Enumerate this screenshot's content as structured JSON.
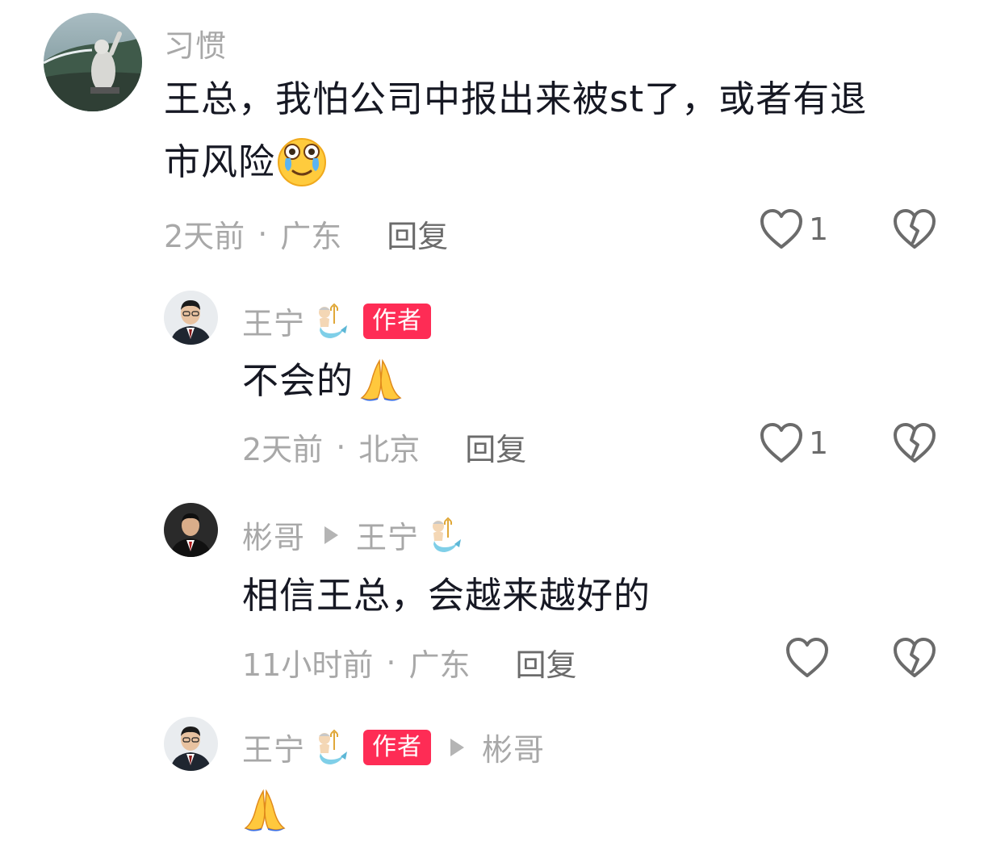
{
  "comments": [
    {
      "username": "习惯",
      "text": "王总，我怕公司中报出来被st了，或者有退市风险",
      "text_line1": "王总，我怕公司中报出来被st了，或者有退",
      "text_line2": "市风险",
      "time": "2天前",
      "location": "广东",
      "reply_label": "回复",
      "likes": "1"
    },
    {
      "username": "王宁",
      "badge": "作者",
      "text": "不会的",
      "time": "2天前",
      "location": "北京",
      "reply_label": "回复",
      "likes": "1"
    },
    {
      "username": "彬哥",
      "reply_to": "王宁",
      "text": "相信王总，会越来越好的",
      "time": "11小时前",
      "location": "广东",
      "reply_label": "回复",
      "likes": ""
    },
    {
      "username": "王宁",
      "badge": "作者",
      "reply_to": "彬哥",
      "text": "",
      "time": "",
      "location": "",
      "reply_label": "",
      "likes": ""
    }
  ],
  "separator": "·",
  "colors": {
    "badge": "#fe2c55",
    "username": "#a8a8a8",
    "text": "#161823",
    "meta": "#a8a8a8"
  }
}
